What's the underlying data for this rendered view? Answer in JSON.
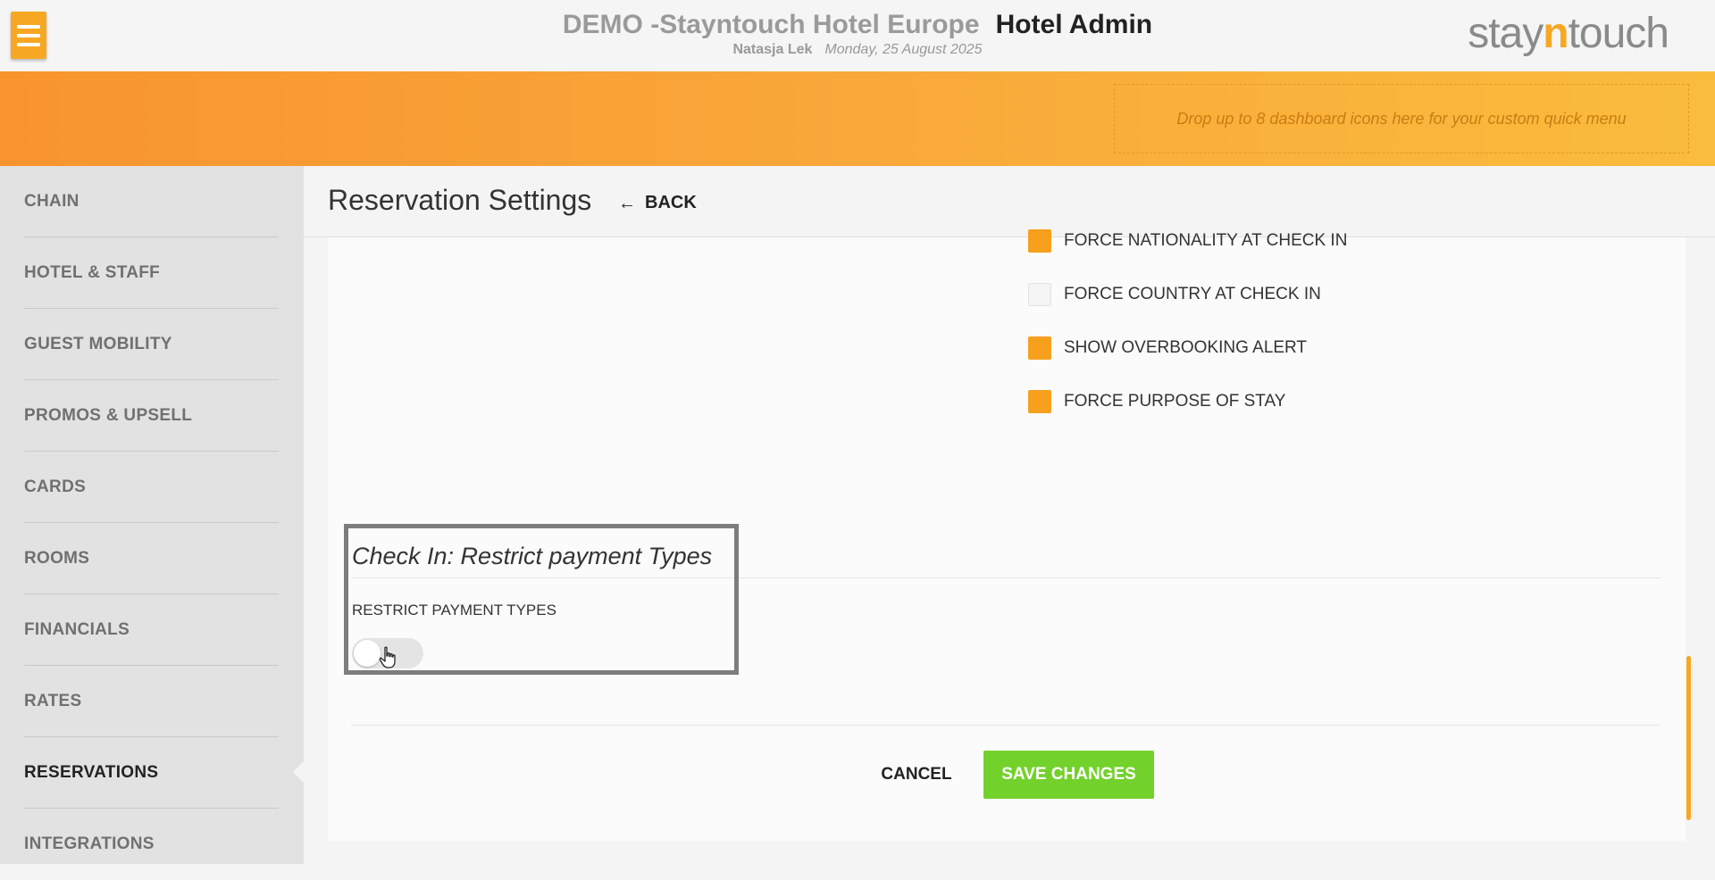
{
  "header": {
    "hotel_name": "DEMO -Stayntouch Hotel Europe",
    "app_name": "Hotel Admin",
    "user_name": "Natasja Lek",
    "date": "Monday, 25 August 2025",
    "logo": {
      "pre": "stay",
      "n": "n",
      "post": "touch"
    }
  },
  "quick_menu": {
    "dropzone_text": "Drop up to 8 dashboard icons here for your custom quick menu"
  },
  "sidebar": {
    "items": [
      {
        "label": "CHAIN"
      },
      {
        "label": "HOTEL & STAFF"
      },
      {
        "label": "GUEST MOBILITY"
      },
      {
        "label": "PROMOS & UPSELL"
      },
      {
        "label": "CARDS"
      },
      {
        "label": "ROOMS"
      },
      {
        "label": "FINANCIALS"
      },
      {
        "label": "RATES"
      },
      {
        "label": "RESERVATIONS",
        "active": true
      },
      {
        "label": "INTEGRATIONS"
      }
    ]
  },
  "page": {
    "title": "Reservation Settings",
    "back_label": "BACK"
  },
  "options": [
    {
      "label": "FORCE NATIONALITY AT CHECK IN",
      "checked": true
    },
    {
      "label": "FORCE COUNTRY AT CHECK IN",
      "checked": false
    },
    {
      "label": "SHOW OVERBOOKING ALERT",
      "checked": true
    },
    {
      "label": "FORCE PURPOSE OF STAY",
      "checked": true
    }
  ],
  "checkin_section": {
    "title": "Check In: Restrict payment Types",
    "field_label": "RESTRICT PAYMENT TYPES",
    "toggle_on": false
  },
  "actions": {
    "cancel_label": "CANCEL",
    "save_label": "SAVE CHANGES"
  },
  "colors": {
    "accent": "#f7a823",
    "save": "#73d12b"
  }
}
